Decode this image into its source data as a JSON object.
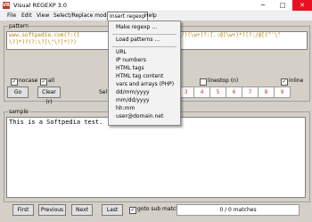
{
  "window": {
    "app_icon": "VR",
    "title": "Visual REGEXP 3.0"
  },
  "title_buttons": {
    "minimize": "─",
    "maximize": "□",
    "close": "✕"
  },
  "menu": [
    {
      "label": "File"
    },
    {
      "label": "Edit"
    },
    {
      "label": "View"
    },
    {
      "label": "Select/Replace mode"
    },
    {
      "label": "Insert regexp"
    },
    {
      "label": "Help"
    }
  ],
  "pattern": {
    "label": "pattern",
    "line1": "www.softpedia.com(?:([",
    "line1b": "/)(\\w+(?:[.:@]\\w+)*)(?:/@[(^'\\\"",
    "line2": "\\?]*)?(?:\\?[\\\"\\?]*)?)",
    "nocase": "nocase",
    "all": "all",
    "inline": "inline",
    "linestop": "linestop (n)",
    "go": "Go",
    "clear": "Clear (r)",
    "select_partial": "Sel",
    "numbers": [
      "3",
      "4",
      "5",
      "6",
      "7",
      "8",
      "9"
    ]
  },
  "sample": {
    "label": "sample",
    "text": "This is a Softpedia test."
  },
  "dropdown": {
    "make_regexp": "Make regexp ...",
    "load_patterns": "Load patterns ...",
    "items": [
      "URL",
      "IP numbers",
      "HTML tags",
      "HTML tag content",
      "vars and arrays (PHP)",
      "dd/mm/yyyy",
      "mm/dd/yyyy",
      "hh:mm",
      "user@domain.net"
    ]
  },
  "nav": {
    "first": "First",
    "previous": "Previous",
    "next": "Next",
    "last": "Last",
    "goto_sub": "goto sub matches",
    "status": "0 / 0 matches"
  }
}
